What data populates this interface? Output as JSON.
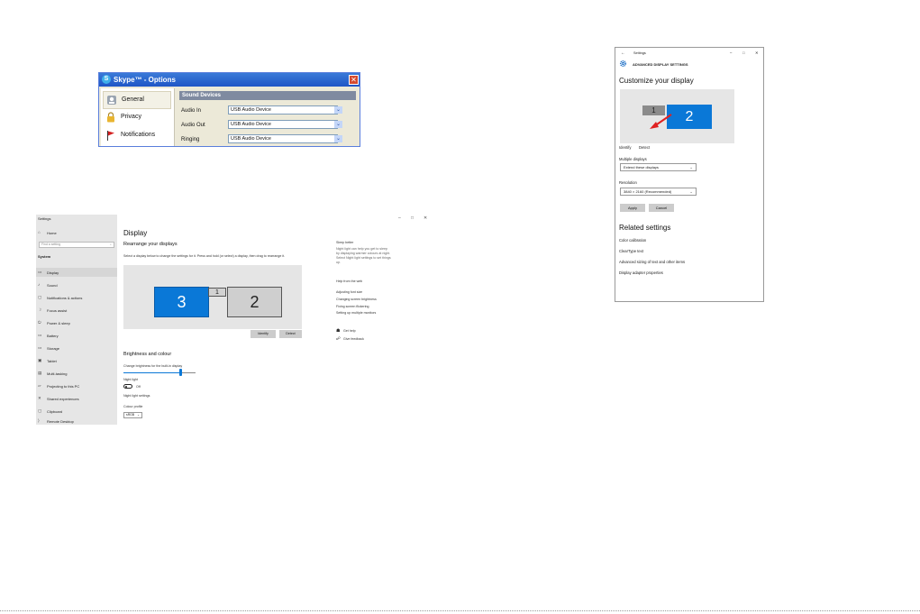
{
  "skype": {
    "logo_letter": "S",
    "title": "Skype™ - Options",
    "close_label": "✕",
    "nav": [
      {
        "label": "General",
        "icon": "general-icon"
      },
      {
        "label": "Privacy",
        "icon": "lock-icon"
      },
      {
        "label": "Notifications",
        "icon": "flag-icon"
      }
    ],
    "section_title": "Sound Devices",
    "devices": [
      {
        "label": "Audio In",
        "value": "USB Audio Device"
      },
      {
        "label": "Audio Out",
        "value": "USB Audio Device"
      },
      {
        "label": "Ringing",
        "value": "USB Audio Device"
      }
    ],
    "dropdown_glyph": "⌄"
  },
  "display": {
    "app_title": "Settings",
    "home": "Home",
    "search_placeholder": "Find a setting",
    "group": "System",
    "sidebar": [
      {
        "label": "Display",
        "icon": "▭"
      },
      {
        "label": "Sound",
        "icon": "♪"
      },
      {
        "label": "Notifications & actions",
        "icon": "▢"
      },
      {
        "label": "Focus assist",
        "icon": "☽"
      },
      {
        "label": "Power & sleep",
        "icon": "⏻"
      },
      {
        "label": "Battery",
        "icon": "▭"
      },
      {
        "label": "Storage",
        "icon": "▭"
      },
      {
        "label": "Tablet",
        "icon": "▣"
      },
      {
        "label": "Multi-tasking",
        "icon": "▤"
      },
      {
        "label": "Projecting to this PC",
        "icon": "▱"
      },
      {
        "label": "Shared experiences",
        "icon": "✕"
      },
      {
        "label": "Clipboard",
        "icon": "▢"
      },
      {
        "label": "Remote Desktop",
        "icon": "⟩"
      }
    ],
    "window_controls": {
      "minimize": "–",
      "maximize": "□",
      "close": "✕"
    },
    "title": "Display",
    "rearrange_heading": "Rearrange your displays",
    "rearrange_desc": "Select a display below to change the settings for it. Press and hold (or select) a display, then drag to rearrange it.",
    "monitors": {
      "m3": "3",
      "m1": "1",
      "m2": "2"
    },
    "identify": "Identify",
    "detect": "Detect",
    "brightness_heading": "Brightness and colour",
    "brightness_label": "Change brightness for the built-in display",
    "brightness_value": 0.79,
    "night_light_label": "Night light",
    "night_light_state": "Off",
    "night_light_settings": "Night light settings",
    "colour_profile_label": "Colour profile",
    "colour_profile_value": "sRGB",
    "right": {
      "sleep_heading": "Sleep better",
      "sleep_text_1": "Night light can help you get to sleep",
      "sleep_text_2": "by displaying warmer colours at night.",
      "sleep_text_3": "Select Night light settings to set things",
      "sleep_text_4": "up.",
      "help_heading": "Help from the web",
      "links": [
        "Adjusting font size",
        "Changing screen brightness",
        "Fixing screen flickering",
        "Setting up multiple monitors"
      ],
      "get_help": "Get help",
      "give_feedback": "Give feedback"
    }
  },
  "advanced": {
    "back": "←",
    "app_title": "Settings",
    "window_controls": {
      "minimize": "–",
      "maximize": "□",
      "close": "✕"
    },
    "header": "ADVANCED DISPLAY SETTINGS",
    "heading": "Customize your display",
    "monitors": {
      "m1": "1",
      "m2": "2"
    },
    "identify": "Identify",
    "detect": "Detect",
    "multiple_label": "Multiple displays",
    "multiple_value": "Extend these displays",
    "resolution_label": "Resolution",
    "resolution_value": "3840 × 2160 (Recommended)",
    "apply": "Apply",
    "cancel": "Cancel",
    "related_heading": "Related settings",
    "related_links": [
      "Color calibration",
      "ClearType text",
      "Advanced sizing of text and other items",
      "Display adapter properties"
    ]
  },
  "colors": {
    "accent": "#0a78d7",
    "link": "#1469c4",
    "xp_title": "#1f55c6",
    "arrow": "#e02020"
  }
}
